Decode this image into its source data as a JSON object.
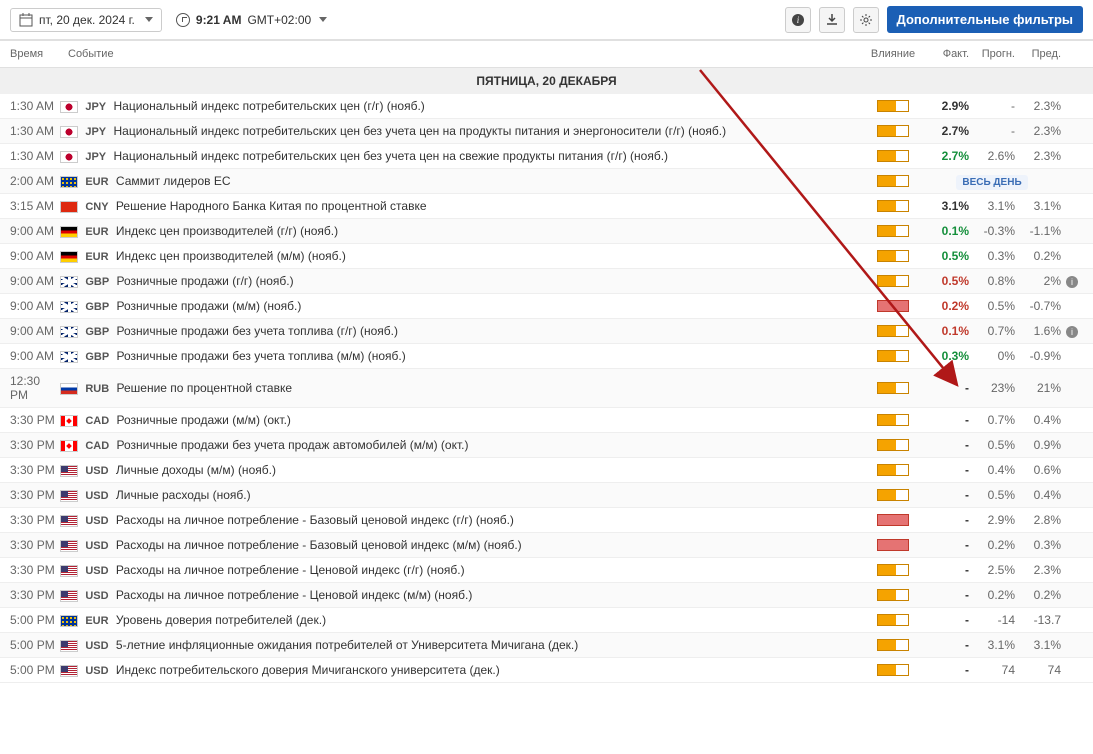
{
  "toolbar": {
    "date": "пт, 20 дек. 2024 г.",
    "time": "9:21 AM",
    "tz": "GMT+02:00",
    "filters": "Дополнительные фильтры"
  },
  "headers": {
    "time": "Время",
    "event": "Событие",
    "impact": "Влияние",
    "fact": "Факт.",
    "prog": "Прогн.",
    "pred": "Пред."
  },
  "date_banner": "ПЯТНИЦА, 20 ДЕКАБРЯ",
  "allday_label": "ВЕСЬ ДЕНЬ",
  "rows": [
    {
      "time": "1:30 AM",
      "flag": "jp",
      "cur": "JPY",
      "name": "Национальный индекс потребительских цен (г/г) (нояб.)",
      "impact": "med",
      "fact": "2.9%",
      "prog": "-",
      "pred": "2.3%"
    },
    {
      "time": "1:30 AM",
      "flag": "jp",
      "cur": "JPY",
      "name": "Национальный индекс потребительских цен без учета цен на продукты питания и энергоносители (г/г) (нояб.)",
      "impact": "med",
      "fact": "2.7%",
      "prog": "-",
      "pred": "2.3%"
    },
    {
      "time": "1:30 AM",
      "flag": "jp",
      "cur": "JPY",
      "name": "Национальный индекс потребительских цен без учета цен на свежие продукты питания (г/г) (нояб.)",
      "impact": "med",
      "fact": "2.7%",
      "fact_color": "green",
      "prog": "2.6%",
      "pred": "2.3%"
    },
    {
      "time": "2:00 AM",
      "flag": "eu",
      "cur": "EUR",
      "name": "Саммит лидеров ЕС",
      "impact": "med",
      "allday": true
    },
    {
      "time": "3:15 AM",
      "flag": "cn",
      "cur": "CNY",
      "name": "Решение Народного Банка Китая по процентной ставке",
      "impact": "med",
      "fact": "3.1%",
      "prog": "3.1%",
      "pred": "3.1%"
    },
    {
      "time": "9:00 AM",
      "flag": "de",
      "cur": "EUR",
      "name": "Индекс цен производителей (г/г) (нояб.)",
      "impact": "med",
      "fact": "0.1%",
      "fact_color": "green",
      "prog": "-0.3%",
      "pred": "-1.1%"
    },
    {
      "time": "9:00 AM",
      "flag": "de",
      "cur": "EUR",
      "name": "Индекс цен производителей (м/м) (нояб.)",
      "impact": "med",
      "fact": "0.5%",
      "fact_color": "green",
      "prog": "0.3%",
      "pred": "0.2%"
    },
    {
      "time": "9:00 AM",
      "flag": "gb",
      "cur": "GBP",
      "name": "Розничные продажи (г/г) (нояб.)",
      "impact": "med",
      "fact": "0.5%",
      "fact_color": "red",
      "prog": "0.8%",
      "pred": "2%",
      "info": true
    },
    {
      "time": "9:00 AM",
      "flag": "gb",
      "cur": "GBP",
      "name": "Розничные продажи (м/м) (нояб.)",
      "impact": "high",
      "fact": "0.2%",
      "fact_color": "red",
      "prog": "0.5%",
      "pred": "-0.7%"
    },
    {
      "time": "9:00 AM",
      "flag": "gb",
      "cur": "GBP",
      "name": "Розничные продажи без учета топлива (г/г) (нояб.)",
      "impact": "med",
      "fact": "0.1%",
      "fact_color": "red",
      "prog": "0.7%",
      "pred": "1.6%",
      "info": true
    },
    {
      "time": "9:00 AM",
      "flag": "gb",
      "cur": "GBP",
      "name": "Розничные продажи без учета топлива (м/м) (нояб.)",
      "impact": "med",
      "fact": "0.3%",
      "fact_color": "green",
      "prog": "0%",
      "pred": "-0.9%"
    },
    {
      "time": "12:30 PM",
      "flag": "ru",
      "cur": "RUB",
      "name": "Решение по процентной ставке",
      "impact": "med",
      "fact": "-",
      "prog": "23%",
      "pred": "21%"
    },
    {
      "time": "3:30 PM",
      "flag": "ca",
      "cur": "CAD",
      "name": "Розничные продажи (м/м) (окт.)",
      "impact": "med",
      "fact": "-",
      "prog": "0.7%",
      "pred": "0.4%"
    },
    {
      "time": "3:30 PM",
      "flag": "ca",
      "cur": "CAD",
      "name": "Розничные продажи без учета продаж автомобилей (м/м) (окт.)",
      "impact": "med",
      "fact": "-",
      "prog": "0.5%",
      "pred": "0.9%"
    },
    {
      "time": "3:30 PM",
      "flag": "us",
      "cur": "USD",
      "name": "Личные доходы (м/м) (нояб.)",
      "impact": "med",
      "fact": "-",
      "prog": "0.4%",
      "pred": "0.6%"
    },
    {
      "time": "3:30 PM",
      "flag": "us",
      "cur": "USD",
      "name": "Личные расходы (нояб.)",
      "impact": "med",
      "fact": "-",
      "prog": "0.5%",
      "pred": "0.4%"
    },
    {
      "time": "3:30 PM",
      "flag": "us",
      "cur": "USD",
      "name": "Расходы на личное потребление - Базовый ценовой индекс (г/г) (нояб.)",
      "impact": "high",
      "fact": "-",
      "prog": "2.9%",
      "pred": "2.8%"
    },
    {
      "time": "3:30 PM",
      "flag": "us",
      "cur": "USD",
      "name": "Расходы на личное потребление - Базовый ценовой индекс (м/м) (нояб.)",
      "impact": "high",
      "fact": "-",
      "prog": "0.2%",
      "pred": "0.3%"
    },
    {
      "time": "3:30 PM",
      "flag": "us",
      "cur": "USD",
      "name": "Расходы на личное потребление - Ценовой индекс (г/г) (нояб.)",
      "impact": "med",
      "fact": "-",
      "prog": "2.5%",
      "pred": "2.3%"
    },
    {
      "time": "3:30 PM",
      "flag": "us",
      "cur": "USD",
      "name": "Расходы на личное потребление - Ценовой индекс (м/м) (нояб.)",
      "impact": "med",
      "fact": "-",
      "prog": "0.2%",
      "pred": "0.2%"
    },
    {
      "time": "5:00 PM",
      "flag": "eu",
      "cur": "EUR",
      "name": "Уровень доверия потребителей (дек.)",
      "impact": "med",
      "fact": "-",
      "prog": "-14",
      "pred": "-13.7"
    },
    {
      "time": "5:00 PM",
      "flag": "us",
      "cur": "USD",
      "name": "5-летние инфляционные ожидания потребителей от Университета Мичигана (дек.)",
      "impact": "med",
      "fact": "-",
      "prog": "3.1%",
      "pred": "3.1%"
    },
    {
      "time": "5:00 PM",
      "flag": "us",
      "cur": "USD",
      "name": "Индекс потребительского доверия Мичиганского университета (дек.)",
      "impact": "med",
      "fact": "-",
      "prog": "74",
      "pred": "74"
    }
  ]
}
